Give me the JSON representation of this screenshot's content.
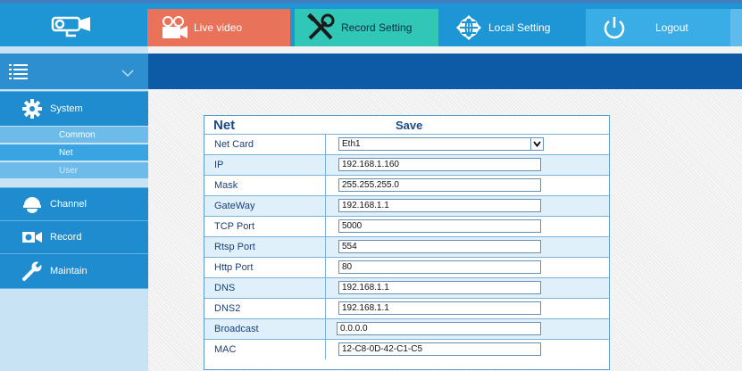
{
  "header": {
    "logo_icon": "camera-logo-icon",
    "nav": [
      {
        "label": "Live video",
        "icon": "video-camera-icon"
      },
      {
        "label": "Record Setting",
        "icon": "tools-icon"
      },
      {
        "label": "Local Setting",
        "icon": "globe-icon"
      },
      {
        "label": "Logout",
        "icon": "power-icon"
      }
    ]
  },
  "sidebar": {
    "menu_icon": "menu-icon",
    "collapse_icon": "chevron-down-icon",
    "sections": [
      {
        "label": "System",
        "icon": "gear-icon",
        "sub": [
          "Common",
          "Net",
          "User"
        ]
      },
      {
        "label": "Channel",
        "icon": "dome-camera-icon"
      },
      {
        "label": "Record",
        "icon": "record-camera-icon"
      },
      {
        "label": "Maintain",
        "icon": "wrench-icon"
      }
    ]
  },
  "panel": {
    "title": "Net",
    "save_label": "Save",
    "rows": [
      {
        "label": "Net Card",
        "value": "Eth1",
        "type": "select"
      },
      {
        "label": "IP",
        "value": "192.168.1.160"
      },
      {
        "label": "Mask",
        "value": "255.255.255.0"
      },
      {
        "label": "GateWay",
        "value": "192.168.1.1"
      },
      {
        "label": "TCP Port",
        "value": "5000"
      },
      {
        "label": "Rtsp Port",
        "value": "554"
      },
      {
        "label": "Http Port",
        "value": "80"
      },
      {
        "label": "DNS",
        "value": "192.168.1.1"
      },
      {
        "label": "DNS2",
        "value": "192.168.1.1"
      },
      {
        "label": "Broadcast",
        "value": "0.0.0.0"
      },
      {
        "label": "MAC",
        "value": "12-C8-0D-42-C1-C5"
      }
    ]
  },
  "colors": {
    "topbar": "#1e96d6",
    "live": "#e8735a",
    "record": "#31c7b7",
    "sidebar_section": "#1f8cd0",
    "header_bar": "#0d5aa7",
    "panel_text": "#1b4a8c"
  }
}
